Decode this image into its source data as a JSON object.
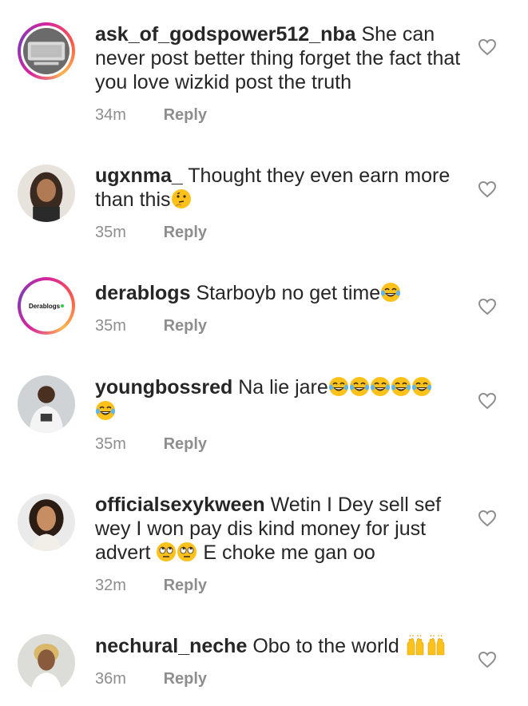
{
  "comments": [
    {
      "username": "ask_of_godspower512_nba",
      "text": "She can never post better thing forget the fact that you love wizkid post the truth",
      "time": "34m",
      "reply": "Reply",
      "avatar": "avatar-logo-nba-icon",
      "story_ring": true
    },
    {
      "username": "ugxnma_",
      "text": "Thought they even earn more than this",
      "emojis": [
        "thinking-face-icon"
      ],
      "time": "35m",
      "reply": "Reply",
      "avatar": "avatar-woman-icon",
      "story_ring": false
    },
    {
      "username": "derablogs",
      "text": "Starboyb no get time",
      "emojis": [
        "tears-of-joy-icon"
      ],
      "time": "35m",
      "reply": "Reply",
      "avatar": "avatar-derablogs-logo",
      "avatar_text": "Derablogs",
      "story_ring": true
    },
    {
      "username": "youngbossred",
      "text": "Na lie jare",
      "emojis": [
        "tears-of-joy-icon",
        "tears-of-joy-icon",
        "tears-of-joy-icon",
        "tears-of-joy-icon",
        "tears-of-joy-icon",
        "tears-of-joy-icon"
      ],
      "time": "35m",
      "reply": "Reply",
      "avatar": "avatar-man-icon",
      "story_ring": false
    },
    {
      "username": "officialsexykween",
      "text": "Wetin I Dey sell sef wey I won pay dis kind money for just advert",
      "emojis": [
        "rolling-eyes-icon",
        "rolling-eyes-icon"
      ],
      "text_after": "E choke me gan oo",
      "time": "32m",
      "reply": "Reply",
      "avatar": "avatar-woman-icon",
      "story_ring": false
    },
    {
      "username": "nechural_neche",
      "text": "Obo to the world",
      "emojis": [
        "raising-hands-icon",
        "raising-hands-icon"
      ],
      "time": "36m",
      "reply": "Reply",
      "avatar": "avatar-woman-icon",
      "story_ring": false
    }
  ],
  "colors": {
    "text": "#262626",
    "meta": "#8e8e8e",
    "heart_stroke": "#8e8e8e",
    "emoji_yellow": "#fcc21b"
  }
}
